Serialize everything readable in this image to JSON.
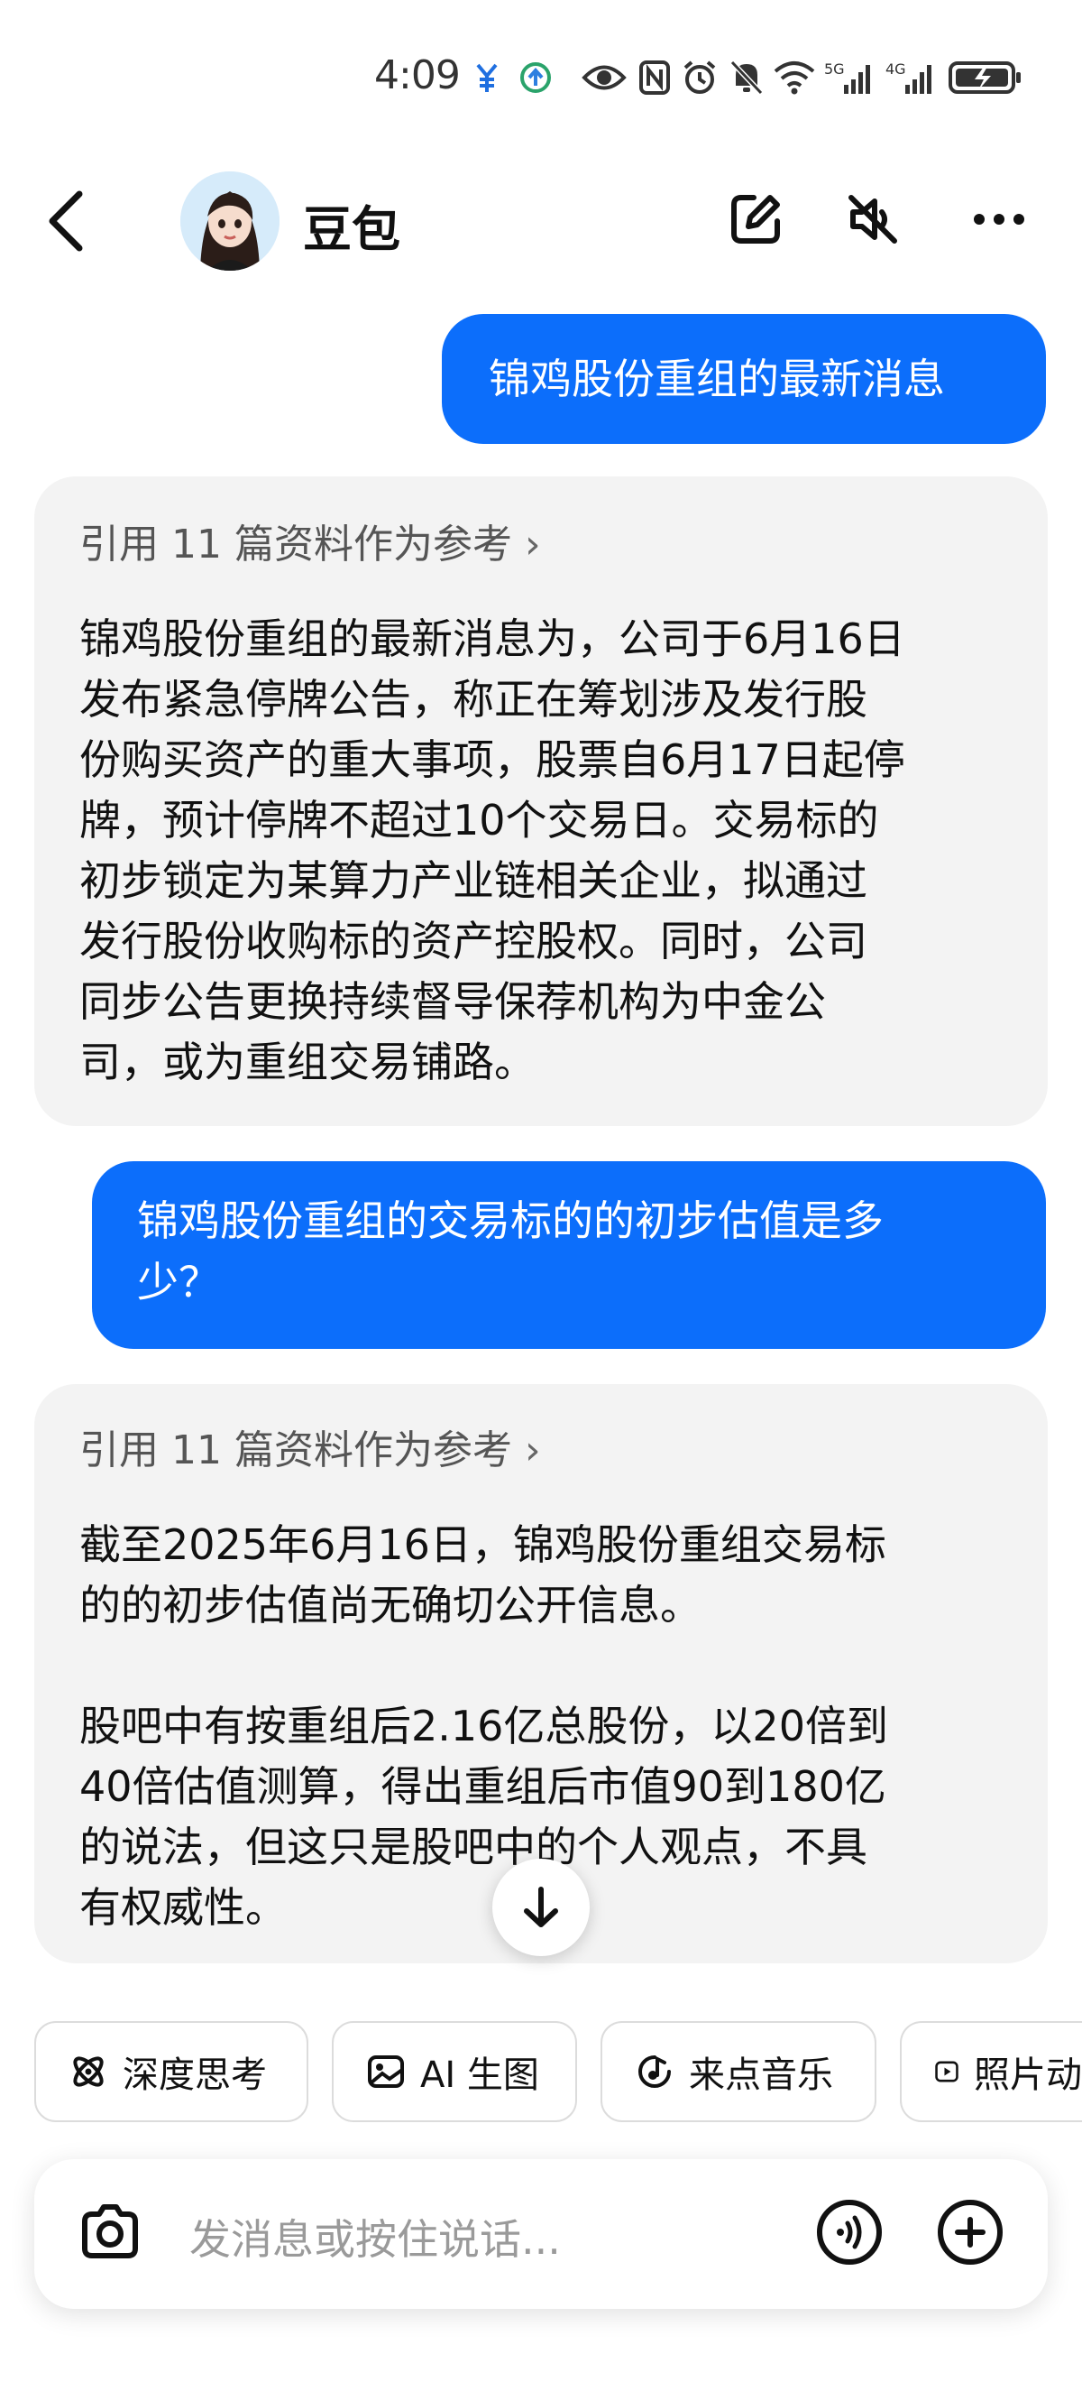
{
  "status_bar": {
    "time": "4:09",
    "icons": [
      "yen-notification-icon",
      "app-notification-icon",
      "eye-icon",
      "nfc-icon",
      "alarm-icon",
      "mute-icon",
      "wifi-icon",
      "5g-signal-icon",
      "4g-signal-icon",
      "battery-charging-icon"
    ],
    "network_5g": "5G",
    "network_4g": "4G"
  },
  "header": {
    "bot_name": "豆包",
    "icons": [
      "back-arrow-icon",
      "edit-icon",
      "speaker-muted-icon",
      "more-icon"
    ]
  },
  "messages": [
    {
      "role": "user",
      "text": "锦鸡股份重组的最新消息"
    },
    {
      "role": "bot",
      "reference": "引用 11 篇资料作为参考",
      "lines": [
        "锦鸡股份重组的最新消息为，公司于6月16日",
        "发布紧急停牌公告，称正在筹划涉及发行股",
        "份购买资产的重大事项，股票自6月17日起停",
        "牌，预计停牌不超过10个交易日。交易标的",
        "初步锁定为某算力产业链相关企业，拟通过",
        "发行股份收购标的资产控股权。同时，公司",
        "同步公告更换持续督导保荐机构为中金公",
        "司，或为重组交易铺路。"
      ]
    },
    {
      "role": "user",
      "lines": [
        "锦鸡股份重组的交易标的的初步估值是多",
        "少？"
      ]
    },
    {
      "role": "bot",
      "reference": "引用 11 篇资料作为参考",
      "para1": [
        "截至2025年6月16日，锦鸡股份重组交易标",
        "的的初步估值尚无确切公开信息。"
      ],
      "para2": [
        "股吧中有按重组后2.16亿总股份，以20倍到",
        "40倍估值测算，得出重组后市值90到180亿",
        "的说法，但这只是股吧中的个人观点，不具",
        "有权威性。"
      ]
    }
  ],
  "chips": [
    {
      "label": "深度思考",
      "icon": "atom-icon"
    },
    {
      "label": "AI 生图",
      "icon": "image-icon"
    },
    {
      "label": "来点音乐",
      "icon": "music-note-icon"
    },
    {
      "label": "照片动",
      "icon": "play-icon"
    }
  ],
  "input": {
    "placeholder": "发消息或按住说话...",
    "icons": [
      "camera-icon",
      "voice-call-icon",
      "plus-icon"
    ]
  },
  "colors": {
    "user_bubble": "#0c6efb",
    "bot_card": "#f3f3f3",
    "reference_text": "#555555",
    "placeholder": "#9a9a9a"
  }
}
